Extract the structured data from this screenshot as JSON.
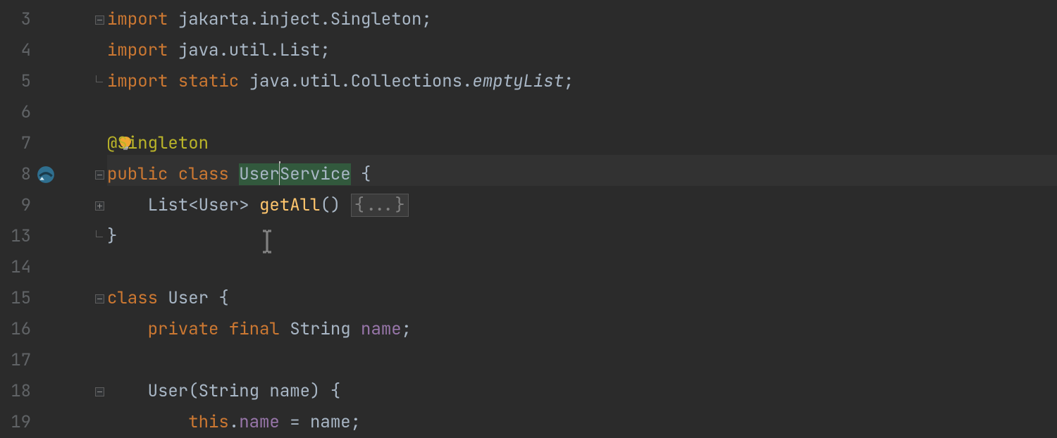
{
  "lineNumbers": [
    "3",
    "4",
    "5",
    "6",
    "7",
    "8",
    "9",
    "13",
    "14",
    "15",
    "16",
    "17",
    "18",
    "19"
  ],
  "lines": {
    "l3": {
      "kw": "import",
      "pkg": " jakarta.inject.Singleton",
      "semi": ";"
    },
    "l4": {
      "kw": "import",
      "pkg": " java.util.List",
      "semi": ";"
    },
    "l5": {
      "kw1": "import",
      "kw2": " static",
      "pkg": " java.util.Collections.",
      "m": "emptyList",
      "semi": ";"
    },
    "l7": {
      "anno": "@Singleton"
    },
    "l8": {
      "kw1": "public",
      "kw2": " class ",
      "sel1": "User",
      "sel2": "Service",
      "tail": " {"
    },
    "l9": {
      "indent": "    ",
      "type1": "List<User> ",
      "m": "getAll",
      "paren": "() ",
      "fold": "{...}"
    },
    "l13": {
      "text": "}"
    },
    "l15": {
      "kw": "class",
      "name": " User {",
      "brace": ""
    },
    "l16": {
      "indent": "    ",
      "kw1": "private",
      "kw2": " final ",
      "type": "String ",
      "field": "name",
      "semi": ";"
    },
    "l18": {
      "indent": "    ",
      "ctor": "User",
      "rest": "(String name) {"
    },
    "l19": {
      "indent": "        ",
      "kw": "this",
      "dot": ".",
      "field": "name",
      "rest": " = name;"
    }
  }
}
